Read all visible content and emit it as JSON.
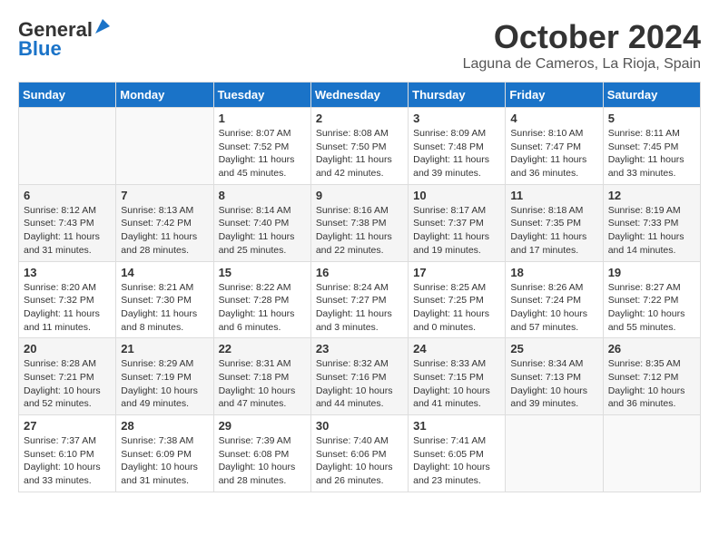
{
  "header": {
    "logo_line1": "General",
    "logo_line2": "Blue",
    "month": "October 2024",
    "location": "Laguna de Cameros, La Rioja, Spain"
  },
  "weekdays": [
    "Sunday",
    "Monday",
    "Tuesday",
    "Wednesday",
    "Thursday",
    "Friday",
    "Saturday"
  ],
  "weeks": [
    [
      {
        "day": "",
        "info": ""
      },
      {
        "day": "",
        "info": ""
      },
      {
        "day": "1",
        "info": "Sunrise: 8:07 AM\nSunset: 7:52 PM\nDaylight: 11 hours and 45 minutes."
      },
      {
        "day": "2",
        "info": "Sunrise: 8:08 AM\nSunset: 7:50 PM\nDaylight: 11 hours and 42 minutes."
      },
      {
        "day": "3",
        "info": "Sunrise: 8:09 AM\nSunset: 7:48 PM\nDaylight: 11 hours and 39 minutes."
      },
      {
        "day": "4",
        "info": "Sunrise: 8:10 AM\nSunset: 7:47 PM\nDaylight: 11 hours and 36 minutes."
      },
      {
        "day": "5",
        "info": "Sunrise: 8:11 AM\nSunset: 7:45 PM\nDaylight: 11 hours and 33 minutes."
      }
    ],
    [
      {
        "day": "6",
        "info": "Sunrise: 8:12 AM\nSunset: 7:43 PM\nDaylight: 11 hours and 31 minutes."
      },
      {
        "day": "7",
        "info": "Sunrise: 8:13 AM\nSunset: 7:42 PM\nDaylight: 11 hours and 28 minutes."
      },
      {
        "day": "8",
        "info": "Sunrise: 8:14 AM\nSunset: 7:40 PM\nDaylight: 11 hours and 25 minutes."
      },
      {
        "day": "9",
        "info": "Sunrise: 8:16 AM\nSunset: 7:38 PM\nDaylight: 11 hours and 22 minutes."
      },
      {
        "day": "10",
        "info": "Sunrise: 8:17 AM\nSunset: 7:37 PM\nDaylight: 11 hours and 19 minutes."
      },
      {
        "day": "11",
        "info": "Sunrise: 8:18 AM\nSunset: 7:35 PM\nDaylight: 11 hours and 17 minutes."
      },
      {
        "day": "12",
        "info": "Sunrise: 8:19 AM\nSunset: 7:33 PM\nDaylight: 11 hours and 14 minutes."
      }
    ],
    [
      {
        "day": "13",
        "info": "Sunrise: 8:20 AM\nSunset: 7:32 PM\nDaylight: 11 hours and 11 minutes."
      },
      {
        "day": "14",
        "info": "Sunrise: 8:21 AM\nSunset: 7:30 PM\nDaylight: 11 hours and 8 minutes."
      },
      {
        "day": "15",
        "info": "Sunrise: 8:22 AM\nSunset: 7:28 PM\nDaylight: 11 hours and 6 minutes."
      },
      {
        "day": "16",
        "info": "Sunrise: 8:24 AM\nSunset: 7:27 PM\nDaylight: 11 hours and 3 minutes."
      },
      {
        "day": "17",
        "info": "Sunrise: 8:25 AM\nSunset: 7:25 PM\nDaylight: 11 hours and 0 minutes."
      },
      {
        "day": "18",
        "info": "Sunrise: 8:26 AM\nSunset: 7:24 PM\nDaylight: 10 hours and 57 minutes."
      },
      {
        "day": "19",
        "info": "Sunrise: 8:27 AM\nSunset: 7:22 PM\nDaylight: 10 hours and 55 minutes."
      }
    ],
    [
      {
        "day": "20",
        "info": "Sunrise: 8:28 AM\nSunset: 7:21 PM\nDaylight: 10 hours and 52 minutes."
      },
      {
        "day": "21",
        "info": "Sunrise: 8:29 AM\nSunset: 7:19 PM\nDaylight: 10 hours and 49 minutes."
      },
      {
        "day": "22",
        "info": "Sunrise: 8:31 AM\nSunset: 7:18 PM\nDaylight: 10 hours and 47 minutes."
      },
      {
        "day": "23",
        "info": "Sunrise: 8:32 AM\nSunset: 7:16 PM\nDaylight: 10 hours and 44 minutes."
      },
      {
        "day": "24",
        "info": "Sunrise: 8:33 AM\nSunset: 7:15 PM\nDaylight: 10 hours and 41 minutes."
      },
      {
        "day": "25",
        "info": "Sunrise: 8:34 AM\nSunset: 7:13 PM\nDaylight: 10 hours and 39 minutes."
      },
      {
        "day": "26",
        "info": "Sunrise: 8:35 AM\nSunset: 7:12 PM\nDaylight: 10 hours and 36 minutes."
      }
    ],
    [
      {
        "day": "27",
        "info": "Sunrise: 7:37 AM\nSunset: 6:10 PM\nDaylight: 10 hours and 33 minutes."
      },
      {
        "day": "28",
        "info": "Sunrise: 7:38 AM\nSunset: 6:09 PM\nDaylight: 10 hours and 31 minutes."
      },
      {
        "day": "29",
        "info": "Sunrise: 7:39 AM\nSunset: 6:08 PM\nDaylight: 10 hours and 28 minutes."
      },
      {
        "day": "30",
        "info": "Sunrise: 7:40 AM\nSunset: 6:06 PM\nDaylight: 10 hours and 26 minutes."
      },
      {
        "day": "31",
        "info": "Sunrise: 7:41 AM\nSunset: 6:05 PM\nDaylight: 10 hours and 23 minutes."
      },
      {
        "day": "",
        "info": ""
      },
      {
        "day": "",
        "info": ""
      }
    ]
  ]
}
